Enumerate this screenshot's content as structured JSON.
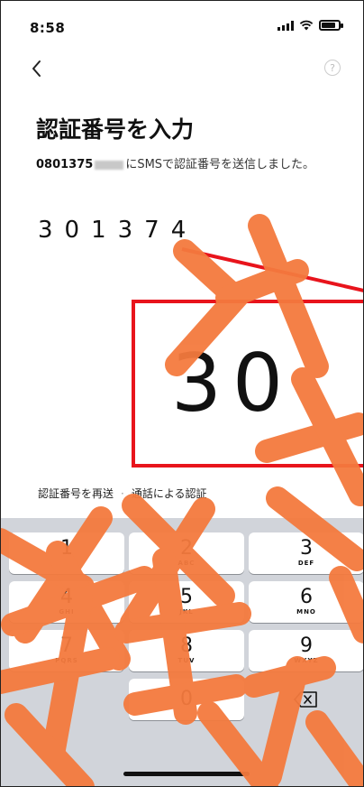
{
  "status_bar": {
    "time": "8:58"
  },
  "nav": {
    "help_label": "?"
  },
  "page": {
    "title": "認証番号を入力",
    "phone_prefix": "0801375",
    "message_suffix": "にSMSで認証番号を送信しました。",
    "code": "301374"
  },
  "links": {
    "resend": "認証番号を再送",
    "separator": "·",
    "call": "通話による認証"
  },
  "zoom": {
    "text": "30"
  },
  "keypad": {
    "keys": [
      {
        "num": "1",
        "letters": ""
      },
      {
        "num": "2",
        "letters": "ABC"
      },
      {
        "num": "3",
        "letters": "DEF"
      },
      {
        "num": "4",
        "letters": "GHI"
      },
      {
        "num": "5",
        "letters": "JKL"
      },
      {
        "num": "6",
        "letters": "MNO"
      },
      {
        "num": "7",
        "letters": "PQRS"
      },
      {
        "num": "8",
        "letters": "TUV"
      },
      {
        "num": "9",
        "letters": "WXYZ"
      },
      {
        "num": "0",
        "letters": ""
      }
    ]
  },
  "colors": {
    "accent_red": "#e8141c",
    "watermark_orange": "#f47a3e",
    "keypad_bg": "#d1d4da"
  },
  "icons": {
    "back": "chevron-left-icon",
    "help": "help-icon",
    "delete": "backspace-icon"
  }
}
